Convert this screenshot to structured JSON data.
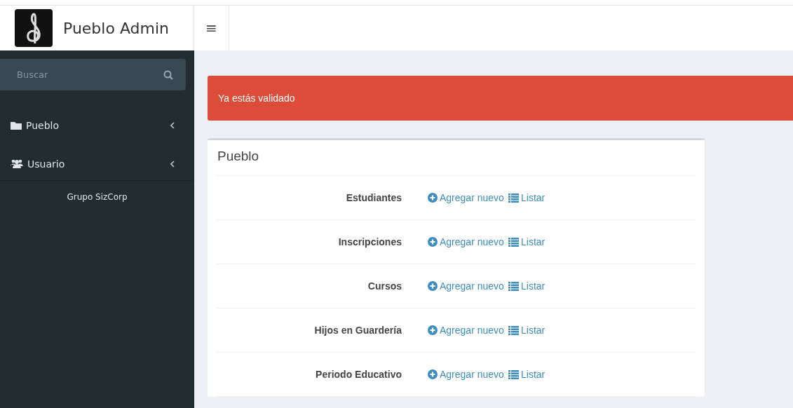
{
  "header": {
    "brand": "Pueblo Admin",
    "toggle": "≡"
  },
  "sidebar": {
    "search": {
      "placeholder": "Buscar"
    },
    "items": [
      {
        "label": "Pueblo",
        "expanded": false
      },
      {
        "label": "Usuario",
        "expanded": false
      }
    ],
    "footer": "Grupo SizCorp"
  },
  "alert": {
    "message": "Ya estás validado"
  },
  "box": {
    "title": "Pueblo",
    "rows": [
      {
        "label": "Estudiantes",
        "add": "Agregar nuevo",
        "list": "Listar"
      },
      {
        "label": "Inscripciones",
        "add": "Agregar nuevo",
        "list": "Listar"
      },
      {
        "label": "Cursos",
        "add": "Agregar nuevo",
        "list": "Listar"
      },
      {
        "label": "Hijos en Guardería",
        "add": "Agregar nuevo",
        "list": "Listar"
      },
      {
        "label": "Periodo Educativo",
        "add": "Agregar nuevo",
        "list": "Listar"
      }
    ]
  }
}
